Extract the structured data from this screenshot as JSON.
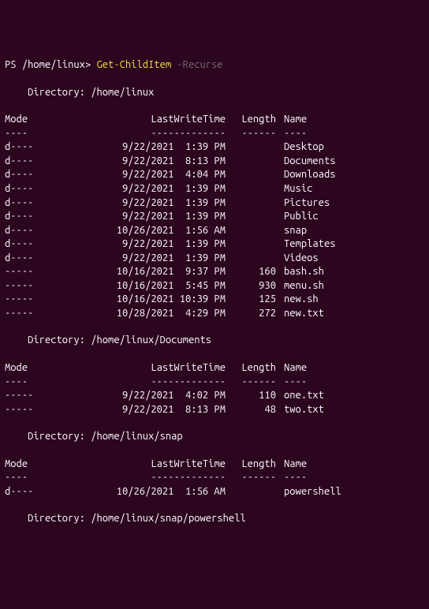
{
  "prompt": {
    "ps": "PS ",
    "path": "/home/linux> ",
    "command": "Get-ChildItem ",
    "arg": "-Recurse"
  },
  "headers": {
    "mode": "Mode",
    "lwt": "LastWriteTime",
    "length": "Length",
    "name": "Name",
    "mode_u": "----",
    "lwt_u": "-------------",
    "length_u": "------",
    "name_u": "----"
  },
  "dir_label": "    Directory: ",
  "sections": [
    {
      "path": "/home/linux",
      "rows": [
        {
          "mode": "d----",
          "date": "9/22/2021",
          "time": " 1:39 PM",
          "len": "",
          "name": "Desktop"
        },
        {
          "mode": "d----",
          "date": "9/22/2021",
          "time": " 8:13 PM",
          "len": "",
          "name": "Documents"
        },
        {
          "mode": "d----",
          "date": "9/22/2021",
          "time": " 4:04 PM",
          "len": "",
          "name": "Downloads"
        },
        {
          "mode": "d----",
          "date": "9/22/2021",
          "time": " 1:39 PM",
          "len": "",
          "name": "Music"
        },
        {
          "mode": "d----",
          "date": "9/22/2021",
          "time": " 1:39 PM",
          "len": "",
          "name": "Pictures"
        },
        {
          "mode": "d----",
          "date": "9/22/2021",
          "time": " 1:39 PM",
          "len": "",
          "name": "Public"
        },
        {
          "mode": "d----",
          "date": "10/26/2021",
          "time": " 1:56 AM",
          "len": "",
          "name": "snap"
        },
        {
          "mode": "d----",
          "date": "9/22/2021",
          "time": " 1:39 PM",
          "len": "",
          "name": "Templates"
        },
        {
          "mode": "d----",
          "date": "9/22/2021",
          "time": " 1:39 PM",
          "len": "",
          "name": "Videos"
        },
        {
          "mode": "-----",
          "date": "10/16/2021",
          "time": " 9:37 PM",
          "len": "160",
          "name": "bash.sh"
        },
        {
          "mode": "-----",
          "date": "10/16/2021",
          "time": " 5:45 PM",
          "len": "930",
          "name": "menu.sh"
        },
        {
          "mode": "-----",
          "date": "10/16/2021",
          "time": "10:39 PM",
          "len": "125",
          "name": "new.sh"
        },
        {
          "mode": "-----",
          "date": "10/28/2021",
          "time": " 4:29 PM",
          "len": "272",
          "name": "new.txt"
        }
      ]
    },
    {
      "path": "/home/linux/Documents",
      "rows": [
        {
          "mode": "-----",
          "date": "9/22/2021",
          "time": " 4:02 PM",
          "len": "110",
          "name": "one.txt"
        },
        {
          "mode": "-----",
          "date": "9/22/2021",
          "time": " 8:13 PM",
          "len": "48",
          "name": "two.txt"
        }
      ]
    },
    {
      "path": "/home/linux/snap",
      "rows": [
        {
          "mode": "d----",
          "date": "10/26/2021",
          "time": " 1:56 AM",
          "len": "",
          "name": "powershell"
        }
      ]
    },
    {
      "path": "/home/linux/snap/powershell",
      "rows": []
    }
  ]
}
